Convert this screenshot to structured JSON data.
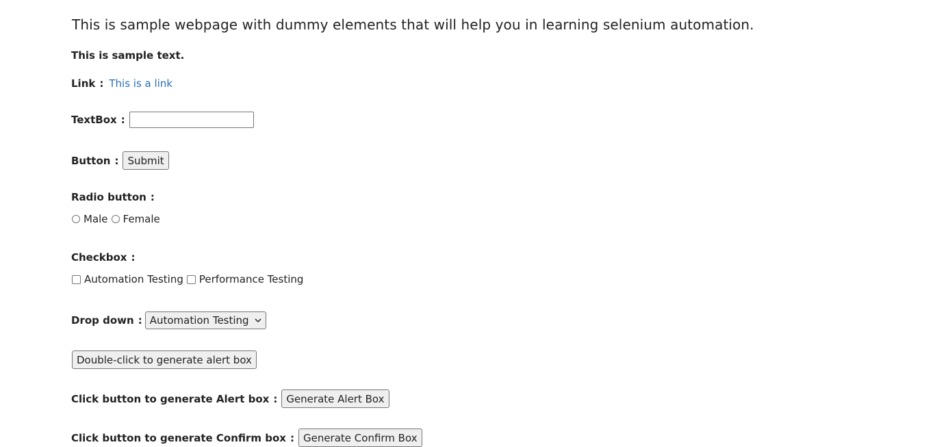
{
  "intro": "This is sample webpage with dummy elements that will help you in learning selenium automation.",
  "sample_text": "This is sample text.",
  "link": {
    "label": "Link",
    "colon": ":",
    "text": "This is a link"
  },
  "textbox": {
    "label": "TextBox",
    "colon": ":",
    "value": "",
    "placeholder": ""
  },
  "button": {
    "label": "Button",
    "colon": ":",
    "submit_label": "Submit"
  },
  "radio": {
    "label": "Radio button",
    "colon": ":",
    "options": [
      "Male",
      "Female"
    ]
  },
  "checkbox": {
    "label": "Checkbox",
    "colon": ":",
    "options": [
      "Automation Testing",
      "Performance Testing"
    ]
  },
  "dropdown": {
    "label": "Drop down",
    "colon": ":",
    "selected": "Automation Testing"
  },
  "double_click_button": "Double-click to generate alert box",
  "alert": {
    "label": "Click button to generate Alert box",
    "colon": ":",
    "button_label": "Generate Alert Box"
  },
  "confirm": {
    "label": "Click button to generate Confirm box",
    "colon": ":",
    "button_label": "Generate Confirm Box"
  },
  "colors": {
    "link": "#2a6fb5",
    "button_bg": "#efefef",
    "border": "#767676",
    "text": "#222222"
  },
  "icons": {
    "dropdown_arrow": "chevron-down-icon"
  }
}
